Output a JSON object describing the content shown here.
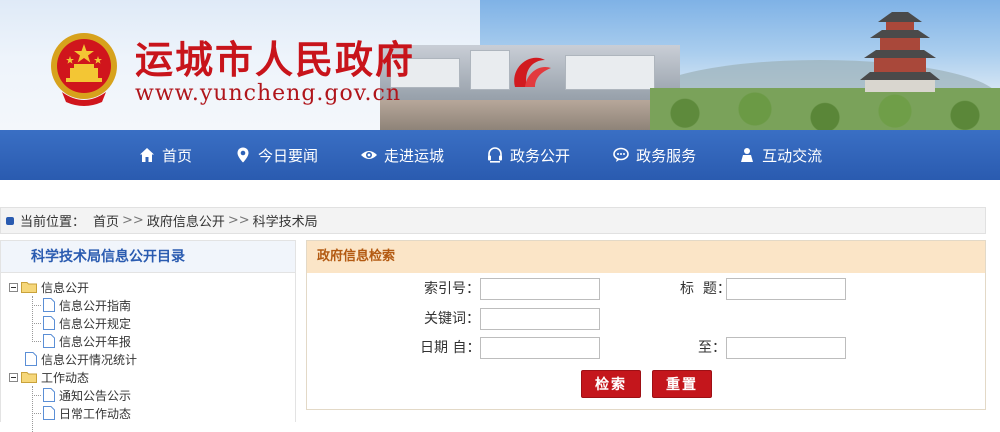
{
  "header": {
    "title": "运城市人民政府",
    "url": "www.yuncheng.gov.cn"
  },
  "nav": {
    "items": [
      {
        "label": "首页",
        "icon": "home-icon"
      },
      {
        "label": "今日要闻",
        "icon": "map-pin-icon"
      },
      {
        "label": "走进运城",
        "icon": "eye-icon"
      },
      {
        "label": "政务公开",
        "icon": "headset-icon"
      },
      {
        "label": "政务服务",
        "icon": "chat-icon"
      },
      {
        "label": "互动交流",
        "icon": "person-icon"
      }
    ]
  },
  "breadcrumb": {
    "prefix": "当前位置：",
    "items": [
      "首页",
      "政府信息公开",
      "科学技术局"
    ],
    "separator": ">>"
  },
  "tree": {
    "title": "科学技术局信息公开目录",
    "nodes": [
      "信息公开",
      "信息公开指南",
      "信息公开规定",
      "信息公开年报",
      "信息公开情况统计",
      "工作动态",
      "通知公告公示",
      "日常工作动态"
    ]
  },
  "search": {
    "title": "政府信息检索",
    "labels": {
      "index": "索引号：",
      "title": "标  题：",
      "keyword": "关键词：",
      "date_from": "日期 自：",
      "date_to": "至："
    },
    "values": {
      "index": "",
      "title": "",
      "keyword": "",
      "date_from": "",
      "date_to": ""
    },
    "buttons": {
      "search": "检索",
      "reset": "重置"
    }
  },
  "colors": {
    "nav_bg": "#2a5bb0",
    "title_red": "#c8141b",
    "button_red": "#c4161c",
    "search_header_bg": "#fbe5c7"
  }
}
